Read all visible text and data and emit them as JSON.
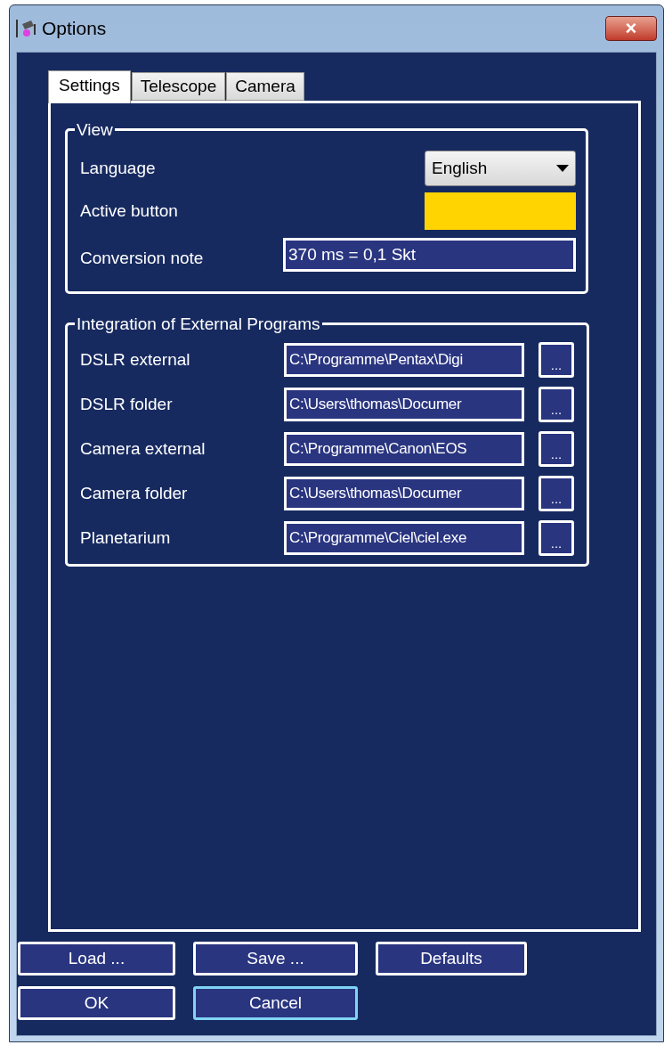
{
  "window": {
    "title": "Options",
    "close": "×"
  },
  "tabs": [
    {
      "label": "Settings",
      "selected": true
    },
    {
      "label": "Telescope",
      "selected": false
    },
    {
      "label": "Camera",
      "selected": false
    }
  ],
  "view": {
    "title": "View",
    "language": {
      "label": "Language",
      "value": "English"
    },
    "active_button": {
      "label": "Active button",
      "color": "#ffd400"
    },
    "conversion_note": {
      "label": "Conversion note",
      "value": "370 ms = 0,1 Skt"
    }
  },
  "integration": {
    "title": "Integration of External Programs",
    "rows": [
      {
        "label": "DSLR external",
        "value": "C:\\Programme\\Pentax\\Digi",
        "browse": "..."
      },
      {
        "label": "DSLR folder",
        "value": "C:\\Users\\thomas\\Documer",
        "browse": "..."
      },
      {
        "label": "Camera external",
        "value": "C:\\Programme\\Canon\\EOS",
        "browse": "..."
      },
      {
        "label": "Camera folder",
        "value": "C:\\Users\\thomas\\Documer",
        "browse": "..."
      },
      {
        "label": "Planetarium",
        "value": "C:\\Programme\\Ciel\\ciel.exe",
        "browse": "..."
      }
    ]
  },
  "buttons": [
    [
      {
        "label": "Load ...",
        "focused": false
      },
      {
        "label": "Save ...",
        "focused": false
      },
      {
        "label": "Defaults",
        "focused": false
      }
    ],
    [
      {
        "label": "OK",
        "focused": false
      },
      {
        "label": "Cancel",
        "focused": true
      }
    ]
  ]
}
